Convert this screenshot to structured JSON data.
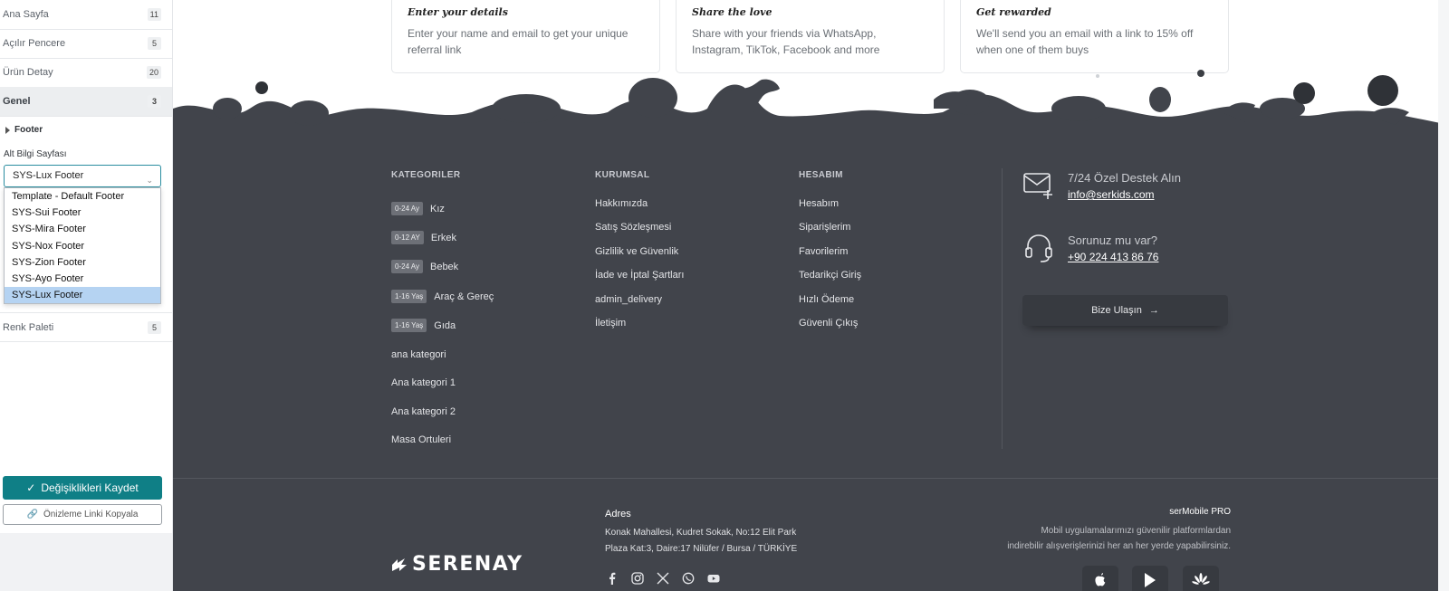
{
  "sidebar": {
    "sections": [
      {
        "label": "Ana Sayfa",
        "count": "11"
      },
      {
        "label": "Açılır Pencere",
        "count": "5"
      },
      {
        "label": "Ürün Detay",
        "count": "20"
      },
      {
        "label": "Genel",
        "count": "3"
      }
    ],
    "subsection": "Footer",
    "field_label": "Alt Bilgi Sayfası",
    "select_value": "SYS-Lux Footer",
    "options": [
      "Template - Default Footer",
      "SYS-Sui Footer",
      "SYS-Mira Footer",
      "SYS-Nox Footer",
      "SYS-Zion Footer",
      "SYS-Ayo Footer",
      "SYS-Lux Footer"
    ],
    "selected_index": 6,
    "palette": {
      "label": "Renk Paleti",
      "count": "5"
    },
    "save_label": "Değişiklikleri Kaydet",
    "copy_label": "Önizleme Linki Kopyala"
  },
  "cards": [
    {
      "title": "Enter your details",
      "text": "Enter your name and email to get your unique referral link"
    },
    {
      "title": "Share the love",
      "text": "Share with your friends via WhatsApp, Instagram, TikTok, Facebook and more"
    },
    {
      "title": "Get rewarded",
      "text": "We'll send you an email with a link to 15% off when one of them buys"
    }
  ],
  "footer": {
    "categories": {
      "title": "KATEGORILER",
      "items": [
        {
          "badge": "0-24 Ay",
          "label": "Kız"
        },
        {
          "badge": "0-12 AY",
          "label": "Erkek"
        },
        {
          "badge": "0-24 Ay",
          "label": "Bebek"
        },
        {
          "badge": "1-16 Yaş",
          "label": "Araç & Gereç"
        },
        {
          "badge": "1-16 Yaş",
          "label": "Gıda"
        },
        {
          "badge": "",
          "label": "ana kategori"
        },
        {
          "badge": "",
          "label": "Ana kategori 1"
        },
        {
          "badge": "",
          "label": "Ana kategori 2"
        },
        {
          "badge": "",
          "label": "Masa Ortuleri"
        }
      ]
    },
    "corporate": {
      "title": "KURUMSAL",
      "items": [
        "Hakkımızda",
        "Satış Sözleşmesi",
        "Gizlilik ve Güvenlik",
        "İade ve İptal Şartları",
        "admin_delivery",
        "İletişim"
      ]
    },
    "account": {
      "title": "HESABIM",
      "items": [
        "Hesabım",
        "Siparişlerim",
        "Favorilerim",
        "Tedarikçi Giriş",
        "Hızlı Ödeme",
        "Güvenli Çıkış"
      ]
    },
    "contact": {
      "support_title": "7/24 Özel Destek Alın",
      "email": "info@serkids.com",
      "question": "Sorunuz mu var?",
      "phone": "+90 224 413 86 76",
      "button_label": "Bize Ulaşın"
    },
    "address": {
      "title": "Adres",
      "line1": "Konak Mahallesi, Kudret Sokak, No:12 Elit Park",
      "line2": "Plaza Kat:3, Daire:17 Nilüfer / Bursa / TÜRKİYE"
    },
    "brand": "SERENAY",
    "mobile": {
      "title": "serMobile PRO",
      "line1": "Mobil uygulamalarımızı güvenilir platformlardan",
      "line2": "indirebilir alışverişlerinizi her an her yerde yapabilirsiniz."
    },
    "social_icons": [
      "facebook-icon",
      "instagram-icon",
      "x-icon",
      "whatsapp-icon",
      "youtube-icon"
    ],
    "store_icons": [
      "apple-icon",
      "google-play-icon",
      "huawei-icon"
    ]
  },
  "colors": {
    "accent": "#0f7f86",
    "footer_bg": "#41444b",
    "selected_option": "#b5d3f2"
  }
}
